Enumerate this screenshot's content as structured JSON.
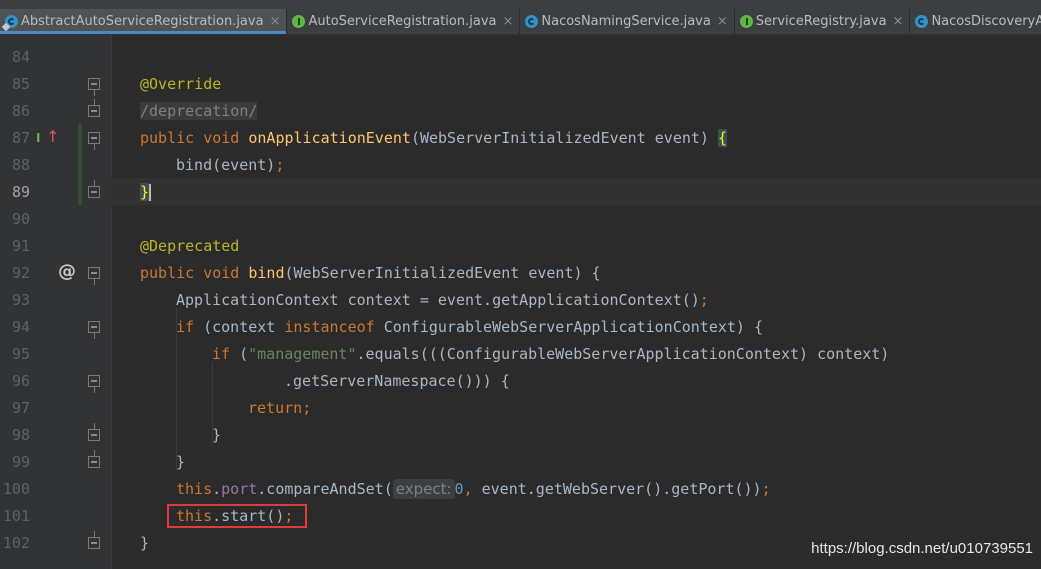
{
  "tabs": [
    {
      "label": "AbstractAutoServiceRegistration.java",
      "icon": "abstract-class-icon",
      "active": true,
      "closable": true
    },
    {
      "label": "AutoServiceRegistration.java",
      "icon": "interface-icon",
      "active": false,
      "closable": true
    },
    {
      "label": "NacosNamingService.java",
      "icon": "class-icon",
      "active": false,
      "closable": true
    },
    {
      "label": "ServiceRegistry.java",
      "icon": "interface-icon",
      "active": false,
      "closable": true
    },
    {
      "label": "NacosDiscoveryAutoConfigurati",
      "icon": "class-icon",
      "active": false,
      "closable": false
    }
  ],
  "close_glyph": "×",
  "editor": {
    "lines": [
      {
        "n": "84"
      },
      {
        "n": "85",
        "t": [
          "@Override"
        ]
      },
      {
        "n": "86",
        "t": [
          "/deprecation/"
        ]
      },
      {
        "n": "87",
        "t": [
          "public void ",
          "onApplicationEvent",
          "(WebServerInitializedEvent event) ",
          "{"
        ]
      },
      {
        "n": "88",
        "t": [
          "bind(event)",
          ";"
        ]
      },
      {
        "n": "89",
        "t": [
          "}"
        ]
      },
      {
        "n": "90"
      },
      {
        "n": "91",
        "t": [
          "@Deprecated"
        ]
      },
      {
        "n": "92",
        "t": [
          "public void ",
          "bind",
          "(WebServerInitializedEvent event) {"
        ]
      },
      {
        "n": "93",
        "t": [
          "ApplicationContext context = event.getApplicationContext()",
          ";"
        ]
      },
      {
        "n": "94",
        "t": [
          "if ",
          "(context ",
          "instanceof ",
          "ConfigurableWebServerApplicationContext) {"
        ]
      },
      {
        "n": "95",
        "t": [
          "if ",
          "(",
          "\"management\"",
          ".equals(((ConfigurableWebServerApplicationContext) context)"
        ]
      },
      {
        "n": "96",
        "t": [
          ".getServerNamespace())) {"
        ]
      },
      {
        "n": "97",
        "t": [
          "return",
          ";"
        ]
      },
      {
        "n": "98",
        "t": [
          "}"
        ]
      },
      {
        "n": "99",
        "t": [
          "}"
        ]
      },
      {
        "n": "100",
        "t": [
          "this",
          ".",
          "port",
          ".compareAndSet(",
          "expect:",
          "0",
          ", ",
          "event.getWebServer().getPort())",
          ";"
        ]
      },
      {
        "n": "101",
        "t": [
          "this",
          ".start()",
          ";"
        ]
      },
      {
        "n": "102",
        "t": [
          "}"
        ]
      }
    ]
  },
  "gutter_marks": {
    "implements_mark": "I",
    "override_arrow": "↑",
    "at_sign": "@"
  },
  "watermark": "https://blog.csdn.net/u010739551",
  "colors": {
    "keyword": "#cc7832",
    "annotation": "#bbb529",
    "method_decl": "#ffc66d",
    "field": "#9876aa",
    "string": "#6a8759",
    "number": "#6897bb",
    "highlight_box": "#e03c3c"
  }
}
